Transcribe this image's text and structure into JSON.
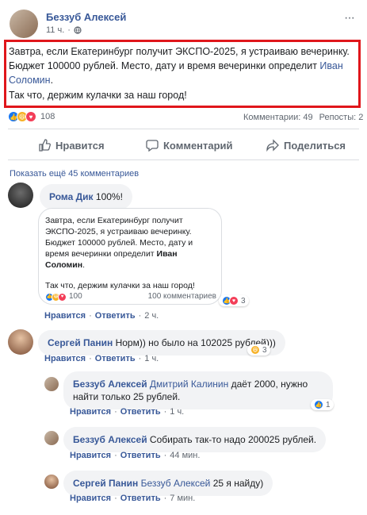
{
  "post": {
    "author": "Беззуб Алексей",
    "time": "11 ч.",
    "text_line1": "Завтра, если Екатеринбург получит ЭКСПО-2025, я устраиваю вечеринку. Бюджет 100000 рублей. Место, дату и время вечеринки определит ",
    "mention": "Иван Соломин",
    "text_end": ".",
    "text_line2": "Так что, держим кулачки за наш город!",
    "reaction_count": "108",
    "comments_count": "Комментарии: 49",
    "reposts_count": "Репосты: 2"
  },
  "actions": {
    "like": "Нравится",
    "comment": "Комментарий",
    "share": "Поделиться"
  },
  "show_more": "Показать ещё 45 комментариев",
  "comments": {
    "c1": {
      "author": "Рома Дик",
      "text": "100%!",
      "embed": {
        "text_a": "Завтра, если Екатеринбург получит ЭКСПО-2025, я устраиваю вечеринку. Бюджет 100000 рублей. Место, дату и время вечеринки определит ",
        "mention": "Иван Соломин",
        "text_b": ".",
        "text_c": "Так что, держим кулачки за наш город!",
        "reactions": "100",
        "comments": "100 комментариев"
      },
      "react_count": "3",
      "like": "Нравится",
      "reply": "Ответить",
      "time": "2 ч."
    },
    "c2": {
      "author": "Сергей Панин",
      "text": "Норм)) но было на 102025 рублей)))",
      "react_count": "3",
      "like": "Нравится",
      "reply": "Ответить",
      "time": "1 ч."
    },
    "r1": {
      "author": "Беззуб Алексей",
      "mention": "Дмитрий Калинин",
      "text": " даёт 2000, нужно найти только 25 рублей.",
      "react_count": "1",
      "like": "Нравится",
      "reply": "Ответить",
      "time": "1 ч."
    },
    "r2": {
      "author": "Беззуб Алексей",
      "text": "Собирать так-то надо 200025 рублей.",
      "like": "Нравится",
      "reply": "Ответить",
      "time": "44 мин."
    },
    "r3": {
      "author": "Сергей Панин",
      "mention": "Беззуб Алексей",
      "text": " 25 я найду)",
      "like": "Нравится",
      "reply": "Ответить",
      "time": "7 мин."
    }
  },
  "colors": {
    "highlight": "#e0161b",
    "link": "#385898",
    "like": "#1877f2"
  }
}
